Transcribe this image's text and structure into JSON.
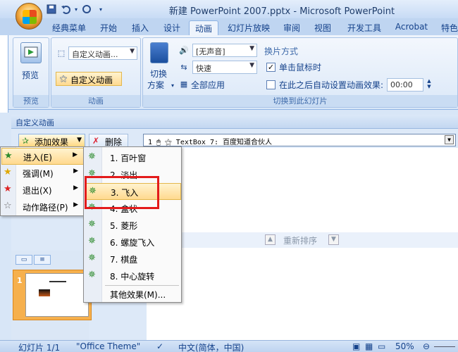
{
  "window": {
    "title": "新建 PowerPoint 2007.pptx - Microsoft PowerPoint"
  },
  "qat": {
    "icons": [
      "save-icon",
      "undo-icon",
      "dropdown-icon",
      "redo-icon",
      "customize-icon"
    ]
  },
  "ribbon_tabs": [
    {
      "label": "经典菜单",
      "active": false
    },
    {
      "label": "开始",
      "active": false
    },
    {
      "label": "插入",
      "active": false
    },
    {
      "label": "设计",
      "active": false
    },
    {
      "label": "动画",
      "active": true
    },
    {
      "label": "幻灯片放映",
      "active": false
    },
    {
      "label": "审阅",
      "active": false
    },
    {
      "label": "视图",
      "active": false
    },
    {
      "label": "开发工具",
      "active": false
    },
    {
      "label": "Acrobat",
      "active": false
    },
    {
      "label": "特色",
      "active": false
    }
  ],
  "ribbon": {
    "preview_group": {
      "button_label": "预览",
      "group_label": "预览"
    },
    "animation_group": {
      "combo_value": "自定义动画...",
      "custom_button": "自定义动画",
      "group_label": "动画"
    },
    "transition_group": {
      "switch_scheme_label_1": "切换",
      "switch_scheme_label_2": "方案",
      "sound_value": "[无声音]",
      "speed_value": "快速",
      "apply_all": "全部应用",
      "method_title": "换片方式",
      "on_click_label": "单击鼠标时",
      "on_click_checked": true,
      "auto_after_label": "在此之后自动设置动画效果:",
      "auto_after_checked": false,
      "auto_after_time": "00:00",
      "group_label": "切换到此幻灯片"
    }
  },
  "pane": {
    "header": "自定义动画",
    "add_effect": "添加效果",
    "remove": "删除",
    "anim_item": "1 🖱 ⚝ TextBox 7: 百度知道合伙人",
    "reorder": "重新排序"
  },
  "menu": {
    "items": [
      {
        "label": "进入(E)",
        "icon": "star-green-icon",
        "highlighted": true
      },
      {
        "label": "强调(M)",
        "icon": "star-yellow-icon",
        "highlighted": false
      },
      {
        "label": "退出(X)",
        "icon": "star-red-icon",
        "highlighted": false
      },
      {
        "label": "动作路径(P)",
        "icon": "star-outline-icon",
        "highlighted": false
      }
    ]
  },
  "submenu": {
    "items": [
      {
        "label": "1. 百叶窗",
        "highlighted": false
      },
      {
        "label": "2. 淡出",
        "highlighted": false
      },
      {
        "label": "3. 飞入",
        "highlighted": true
      },
      {
        "label": "4. 盒状",
        "highlighted": false
      },
      {
        "label": "5. 菱形",
        "highlighted": false
      },
      {
        "label": "6. 螺旋飞入",
        "highlighted": false
      },
      {
        "label": "7. 棋盘",
        "highlighted": false
      },
      {
        "label": "8. 中心旋转",
        "highlighted": false
      }
    ],
    "more": "其他效果(M)..."
  },
  "slides_panel": {
    "slide_number": "1"
  },
  "statusbar": {
    "slide_info": "幻灯片 1/1",
    "theme": "\"Office Theme\"",
    "language": "中文(简体，中国)",
    "zoom": "50%"
  },
  "colors": {
    "highlight": "#ffd98f",
    "annotation_red": "#e31b1b",
    "ribbon_text": "#15428b"
  }
}
